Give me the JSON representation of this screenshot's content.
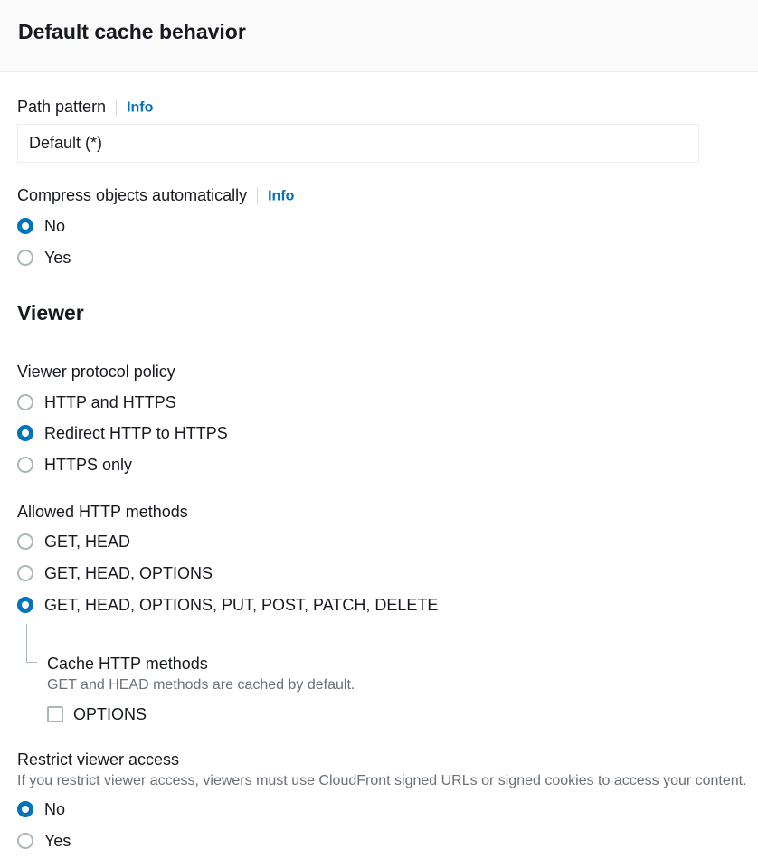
{
  "header": {
    "title": "Default cache behavior"
  },
  "path_pattern": {
    "label": "Path pattern",
    "info": "Info",
    "value": "Default (*)"
  },
  "compress": {
    "label": "Compress objects automatically",
    "info": "Info",
    "options": [
      {
        "label": "No",
        "checked": true
      },
      {
        "label": "Yes",
        "checked": false
      }
    ]
  },
  "viewer": {
    "title": "Viewer",
    "protocol_policy": {
      "label": "Viewer protocol policy",
      "options": [
        {
          "label": "HTTP and HTTPS",
          "checked": false
        },
        {
          "label": "Redirect HTTP to HTTPS",
          "checked": true
        },
        {
          "label": "HTTPS only",
          "checked": false
        }
      ]
    },
    "allowed_methods": {
      "label": "Allowed HTTP methods",
      "options": [
        {
          "label": "GET, HEAD",
          "checked": false
        },
        {
          "label": "GET, HEAD, OPTIONS",
          "checked": false
        },
        {
          "label": "GET, HEAD, OPTIONS, PUT, POST, PATCH, DELETE",
          "checked": true
        }
      ],
      "cache_methods": {
        "label": "Cache HTTP methods",
        "description": "GET and HEAD methods are cached by default.",
        "option_label": "OPTIONS",
        "checked": false
      }
    },
    "restrict_access": {
      "label": "Restrict viewer access",
      "description": "If you restrict viewer access, viewers must use CloudFront signed URLs or signed cookies to access your content.",
      "options": [
        {
          "label": "No",
          "checked": true
        },
        {
          "label": "Yes",
          "checked": false
        }
      ]
    }
  },
  "colors": {
    "accent": "#0073bb",
    "text": "#16191f",
    "muted": "#687078",
    "border": "#aab7b8",
    "header_bg": "#fafafa"
  }
}
